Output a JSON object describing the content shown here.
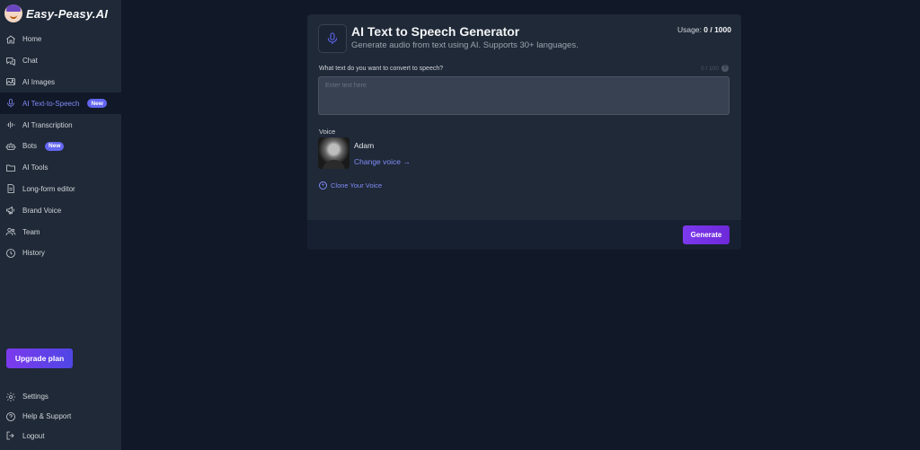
{
  "brand": {
    "name": "Easy-Peasy.AI"
  },
  "sidebar": {
    "items": [
      {
        "label": "Home",
        "icon": "home-icon"
      },
      {
        "label": "Chat",
        "icon": "chat-icon"
      },
      {
        "label": "AI Images",
        "icon": "image-icon"
      },
      {
        "label": "AI Text-to-Speech",
        "icon": "microphone-icon",
        "badge": "New",
        "active": true
      },
      {
        "label": "AI Transcription",
        "icon": "waveform-icon"
      },
      {
        "label": "Bots",
        "icon": "robot-icon",
        "badge": "New"
      },
      {
        "label": "AI Tools",
        "icon": "folder-icon"
      },
      {
        "label": "Long-form editor",
        "icon": "document-icon"
      },
      {
        "label": "Brand Voice",
        "icon": "megaphone-icon"
      },
      {
        "label": "Team",
        "icon": "users-icon"
      },
      {
        "label": "History",
        "icon": "clock-icon"
      }
    ],
    "upgrade_label": "Upgrade plan",
    "bottom_items": [
      {
        "label": "Settings",
        "icon": "gear-icon"
      },
      {
        "label": "Help & Support",
        "icon": "help-icon"
      },
      {
        "label": "Logout",
        "icon": "logout-icon"
      }
    ]
  },
  "main": {
    "title": "AI Text to Speech Generator",
    "subtitle": "Generate audio from text using AI. Supports 30+ languages.",
    "usage_label": "Usage:",
    "usage_value": "0 / 1000",
    "prompt_label": "What text do you want to convert to speech?",
    "char_count": "0 / 100",
    "text_placeholder": "Enter text here",
    "voice_label": "Voice",
    "voice_name": "Adam",
    "change_voice_label": "Change voice →",
    "clone_voice_label": "Clone Your Voice",
    "generate_label": "Generate"
  },
  "colors": {
    "accent": "#6366f1",
    "button_gradient_start": "#7c3aed",
    "background": "#111827",
    "panel": "#1f2937"
  }
}
